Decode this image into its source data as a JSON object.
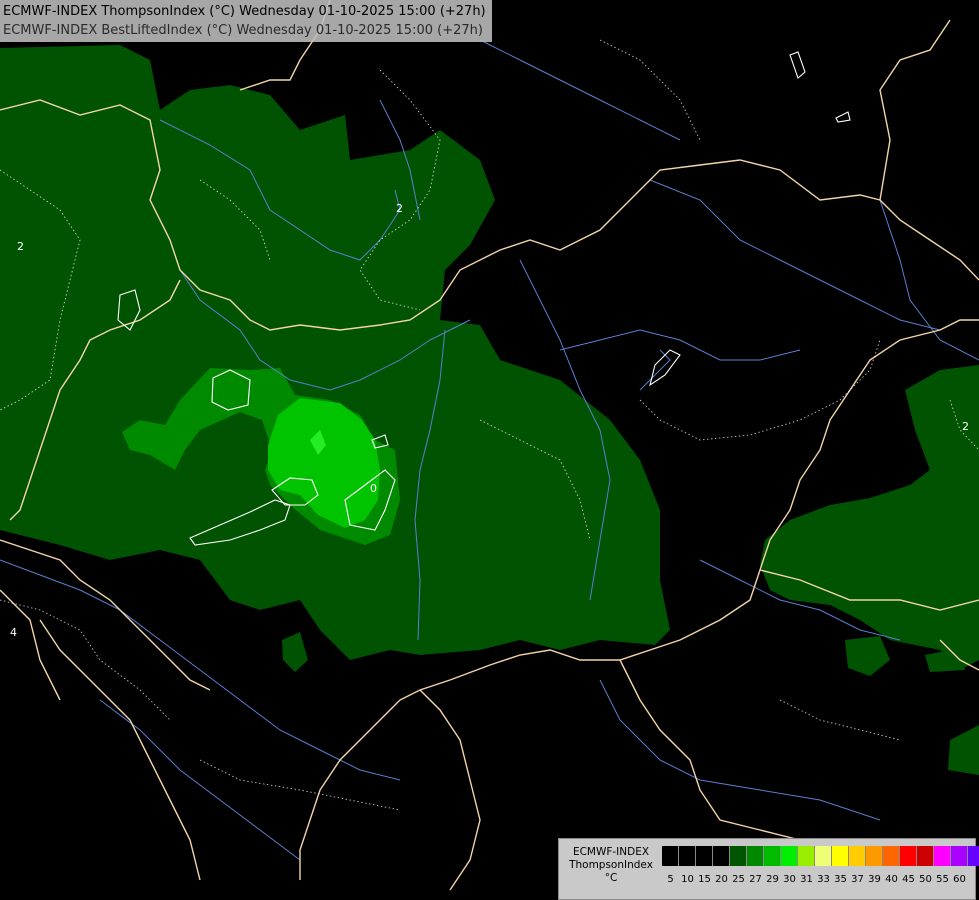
{
  "title": {
    "line1": "ECMWF-INDEX ThompsonIndex (°C) Wednesday 01-10-2025 15:00 (+27h)",
    "line2": "ECMWF-INDEX BestLiftedIndex (°C) Wednesday 01-10-2025 15:00 (+27h)"
  },
  "legend": {
    "model": "ECMWF-INDEX",
    "parameter": "ThompsonIndex",
    "unit": "°C",
    "ticks": [
      "5",
      "10",
      "15",
      "20",
      "25",
      "27",
      "29",
      "30",
      "31",
      "33",
      "35",
      "37",
      "39",
      "40",
      "45",
      "50",
      "55",
      "60"
    ],
    "colors": [
      "#000000",
      "#000000",
      "#000000",
      "#000000",
      "#005500",
      "#008800",
      "#00bb00",
      "#00ee00",
      "#99ee00",
      "#eeff77",
      "#ffff00",
      "#ffcc00",
      "#ff9900",
      "#ff6600",
      "#ff0000",
      "#cc0000",
      "#ff00ff",
      "#aa00ff",
      "#6600ff",
      "#0000ff"
    ]
  },
  "contour_labels": [
    "2",
    "2",
    "0",
    "2",
    "4"
  ],
  "colors": {
    "background": "#000000",
    "field_20_25": "#005300",
    "field_25_27": "#008a00",
    "field_27_29": "#00c400",
    "field_29_30": "#22ee22",
    "border": "#f3d5a8",
    "river": "#5b7fd1",
    "contour": "#ffffff"
  }
}
